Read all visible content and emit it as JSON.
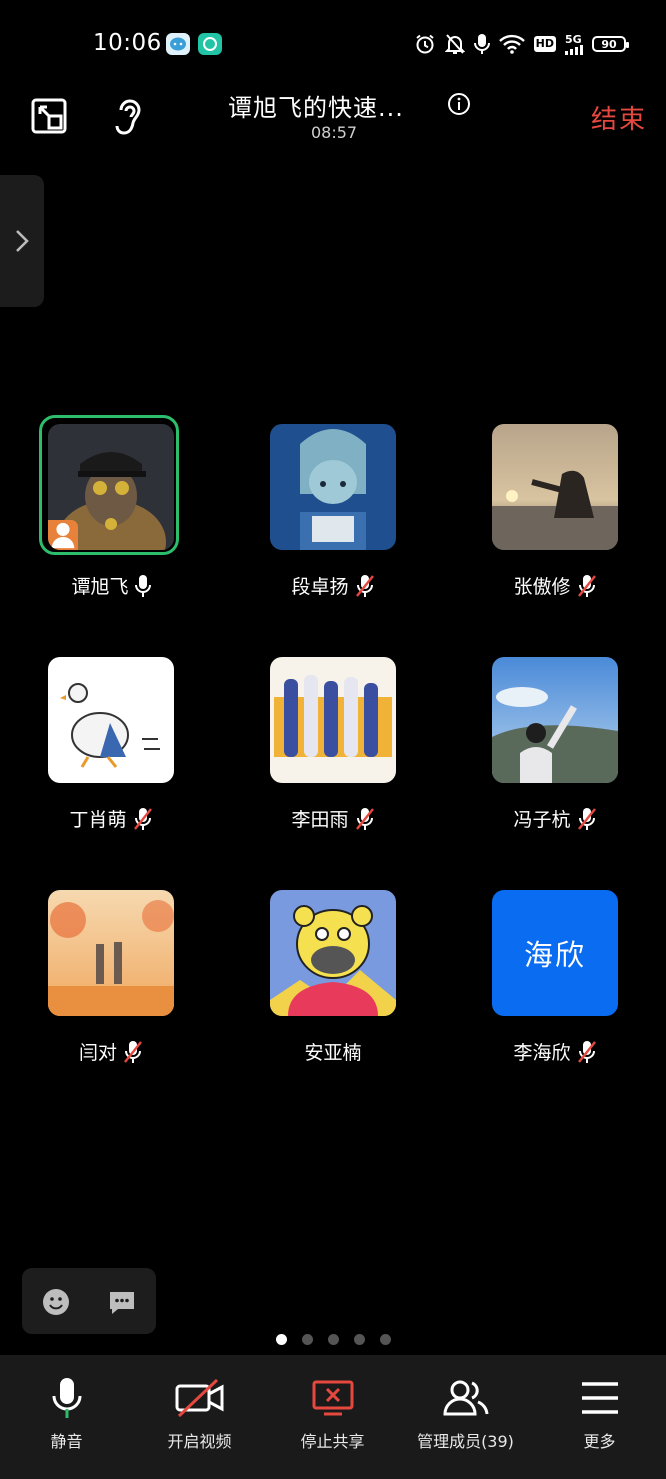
{
  "status_bar": {
    "time": "10:06",
    "hd": "HD",
    "network": "5G",
    "battery": "90"
  },
  "header": {
    "title": "谭旭飞的快速...",
    "timer": "08:57",
    "end_label": "结束"
  },
  "participants": [
    {
      "name": "谭旭飞",
      "mic": "on",
      "host": true,
      "speaking": true
    },
    {
      "name": "段卓扬",
      "mic": "muted"
    },
    {
      "name": "张傲修",
      "mic": "muted"
    },
    {
      "name": "丁肖萌",
      "mic": "muted"
    },
    {
      "name": "李田雨",
      "mic": "muted"
    },
    {
      "name": "冯子杭",
      "mic": "muted"
    },
    {
      "name": "闫对",
      "mic": "muted"
    },
    {
      "name": "安亚楠",
      "mic": "none"
    },
    {
      "name": "李海欣",
      "mic": "muted",
      "avatar_text": "海欣",
      "avatar_color": "#0a6cf0"
    }
  ],
  "pagination": {
    "total": 5,
    "current": 1
  },
  "toolbar": {
    "mute": "静音",
    "video": "开启视频",
    "share": "停止共享",
    "members": "管理成员(39)",
    "more": "更多"
  },
  "colors": {
    "end": "#e5483f",
    "speaking_ring": "#2dbe6c",
    "host_badge": "#e8823a",
    "share_icon": "#e5483f"
  }
}
